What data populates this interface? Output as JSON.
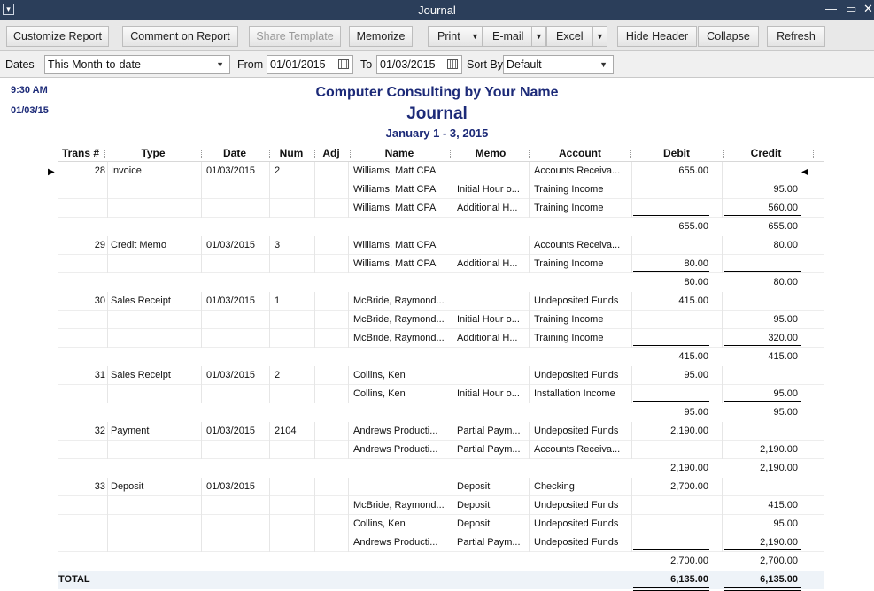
{
  "window": {
    "title": "Journal",
    "menu_glyph": "▾",
    "min": "—",
    "max": "▭",
    "close": "✕"
  },
  "toolbar": {
    "customize": "Customize Report",
    "comment": "Comment on Report",
    "share": "Share Template",
    "memorize": "Memorize",
    "print": "Print",
    "email": "E-mail",
    "excel": "Excel",
    "hide_header": "Hide Header",
    "collapse": "Collapse",
    "refresh": "Refresh"
  },
  "filters": {
    "dates_label": "Dates",
    "dates_value": "This Month-to-date",
    "from_label": "From",
    "from_value": "01/01/2015",
    "to_label": "To",
    "to_value": "01/03/2015",
    "sort_label": "Sort By",
    "sort_value": "Default"
  },
  "report": {
    "time": "9:30 AM",
    "date": "01/03/15",
    "company": "Computer Consulting by Your Name",
    "title": "Journal",
    "range": "January 1 - 3, 2015"
  },
  "columns": [
    "Trans #",
    "Type",
    "Date",
    "Num",
    "Adj",
    "Name",
    "Memo",
    "Account",
    "Debit",
    "Credit"
  ],
  "transactions": [
    {
      "trans": "28",
      "type": "Invoice",
      "date": "01/03/2015",
      "num": "2",
      "lines": [
        {
          "name": "Williams, Matt CPA",
          "memo": "",
          "account": "Accounts Receiva...",
          "debit": "655.00",
          "credit": ""
        },
        {
          "name": "Williams, Matt CPA",
          "memo": "Initial Hour o...",
          "account": "Training Income",
          "debit": "",
          "credit": "95.00"
        },
        {
          "name": "Williams, Matt CPA",
          "memo": "Additional H...",
          "account": "Training Income",
          "debit": "",
          "credit": "560.00"
        }
      ],
      "total_debit": "655.00",
      "total_credit": "655.00"
    },
    {
      "trans": "29",
      "type": "Credit Memo",
      "date": "01/03/2015",
      "num": "3",
      "lines": [
        {
          "name": "Williams, Matt CPA",
          "memo": "",
          "account": "Accounts Receiva...",
          "debit": "",
          "credit": "80.00"
        },
        {
          "name": "Williams, Matt CPA",
          "memo": "Additional H...",
          "account": "Training Income",
          "debit": "80.00",
          "credit": ""
        }
      ],
      "total_debit": "80.00",
      "total_credit": "80.00"
    },
    {
      "trans": "30",
      "type": "Sales Receipt",
      "date": "01/03/2015",
      "num": "1",
      "lines": [
        {
          "name": "McBride, Raymond...",
          "memo": "",
          "account": "Undeposited Funds",
          "debit": "415.00",
          "credit": ""
        },
        {
          "name": "McBride, Raymond...",
          "memo": "Initial Hour o...",
          "account": "Training Income",
          "debit": "",
          "credit": "95.00"
        },
        {
          "name": "McBride, Raymond...",
          "memo": "Additional H...",
          "account": "Training Income",
          "debit": "",
          "credit": "320.00"
        }
      ],
      "total_debit": "415.00",
      "total_credit": "415.00"
    },
    {
      "trans": "31",
      "type": "Sales Receipt",
      "date": "01/03/2015",
      "num": "2",
      "lines": [
        {
          "name": "Collins, Ken",
          "memo": "",
          "account": "Undeposited Funds",
          "debit": "95.00",
          "credit": ""
        },
        {
          "name": "Collins, Ken",
          "memo": "Initial Hour o...",
          "account": "Installation Income",
          "debit": "",
          "credit": "95.00"
        }
      ],
      "total_debit": "95.00",
      "total_credit": "95.00"
    },
    {
      "trans": "32",
      "type": "Payment",
      "date": "01/03/2015",
      "num": "2104",
      "lines": [
        {
          "name": "Andrews Producti...",
          "memo": "Partial Paym...",
          "account": "Undeposited Funds",
          "debit": "2,190.00",
          "credit": ""
        },
        {
          "name": "Andrews Producti...",
          "memo": "Partial Paym...",
          "account": "Accounts Receiva...",
          "debit": "",
          "credit": "2,190.00"
        }
      ],
      "total_debit": "2,190.00",
      "total_credit": "2,190.00"
    },
    {
      "trans": "33",
      "type": "Deposit",
      "date": "01/03/2015",
      "num": "",
      "lines": [
        {
          "name": "",
          "memo": "Deposit",
          "account": "Checking",
          "debit": "2,700.00",
          "credit": ""
        },
        {
          "name": "McBride, Raymond...",
          "memo": "Deposit",
          "account": "Undeposited Funds",
          "debit": "",
          "credit": "415.00"
        },
        {
          "name": "Collins, Ken",
          "memo": "Deposit",
          "account": "Undeposited Funds",
          "debit": "",
          "credit": "95.00"
        },
        {
          "name": "Andrews Producti...",
          "memo": "Partial Paym...",
          "account": "Undeposited Funds",
          "debit": "",
          "credit": "2,190.00"
        }
      ],
      "total_debit": "2,700.00",
      "total_credit": "2,700.00"
    }
  ],
  "grand_total": {
    "label": "TOTAL",
    "debit": "6,135.00",
    "credit": "6,135.00"
  },
  "row_markers": {
    "left": "▶",
    "right": "◀"
  }
}
